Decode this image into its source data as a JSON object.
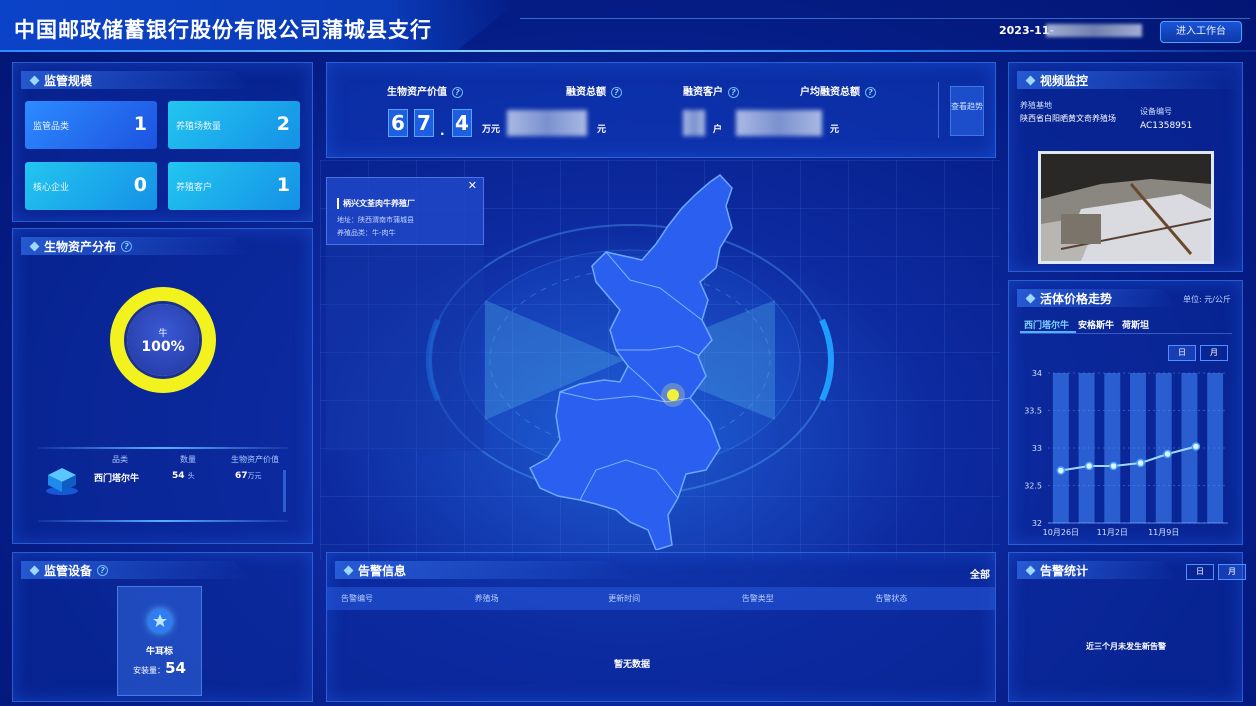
{
  "header": {
    "title": "中国邮政储蓄银行股份有限公司蒲城县支行",
    "date": "2023-11-",
    "work_button": "进入工作台"
  },
  "supervision": {
    "title": "监管规模",
    "cards": [
      {
        "label": "监管品类",
        "value": "1"
      },
      {
        "label": "养殖场数量",
        "value": "2"
      },
      {
        "label": "核心企业",
        "value": "0"
      },
      {
        "label": "养殖客户",
        "value": "1"
      }
    ]
  },
  "distribution": {
    "title": "生物资产分布",
    "donut_label": "牛",
    "donut_value": "100%",
    "headers": [
      "品类",
      "数量",
      "生物资产价值"
    ],
    "row": {
      "name": "西门塔尔牛",
      "count": "54",
      "count_unit": "头",
      "value": "67",
      "value_unit": "万元"
    }
  },
  "metrics": {
    "labels": [
      "生物资产价值",
      "融资总额",
      "融资客户",
      "户均融资总额"
    ],
    "digits": [
      "6",
      "7",
      "4"
    ],
    "dot": ".",
    "unit_wan": "万元",
    "unit_yuan": "元",
    "unit_hu": "户",
    "unit_yuan2": "元",
    "trend_button": "查看趋势"
  },
  "popup": {
    "name": "柄兴文荃肉牛养殖厂",
    "address": "地址：陕西渭南市蒲城县",
    "category": "养殖品类：牛-肉牛"
  },
  "video": {
    "title": "视频监控",
    "base_label": "养殖基地",
    "base_value": "陕西省白阳晒黄文奇养殖场",
    "device_label": "设备编号",
    "device_value": "AC1358951"
  },
  "price": {
    "title": "活体价格走势",
    "unit": "单位: 元/公斤",
    "tabs": [
      "西门塔尔牛",
      "安格斯牛",
      "荷斯坦"
    ],
    "seg": [
      "日",
      "月"
    ]
  },
  "chart_data": {
    "type": "bar+line",
    "categories": [
      "",
      "10月26日",
      "",
      "11月2日",
      "",
      "11月9日",
      ""
    ],
    "x_ticks": [
      "10月26日",
      "11月2日",
      "11月9日"
    ],
    "y_ticks": [
      "34",
      "33.5",
      "33",
      "32.5",
      "32"
    ],
    "ylim": [
      32,
      34
    ],
    "bars": [
      34,
      34,
      34,
      34,
      34,
      34,
      34
    ],
    "line": [
      32.7,
      32.76,
      32.76,
      32.8,
      32.92,
      33.02
    ],
    "line_x": [
      0.45,
      1.55,
      2.5,
      3.55,
      4.6,
      5.7
    ]
  },
  "devices": {
    "title": "监管设备",
    "name": "牛耳标",
    "installed_label": "安装量：",
    "installed_value": "54"
  },
  "alerts": {
    "title": "告警信息",
    "all": "全部",
    "columns": [
      "告警编号",
      "养殖场",
      "更新时间",
      "告警类型",
      "告警状态"
    ],
    "empty": "暂无数据"
  },
  "alert_stats": {
    "title": "告警统计",
    "seg": [
      "日",
      "月"
    ],
    "message": "近三个月未发生新告警"
  }
}
